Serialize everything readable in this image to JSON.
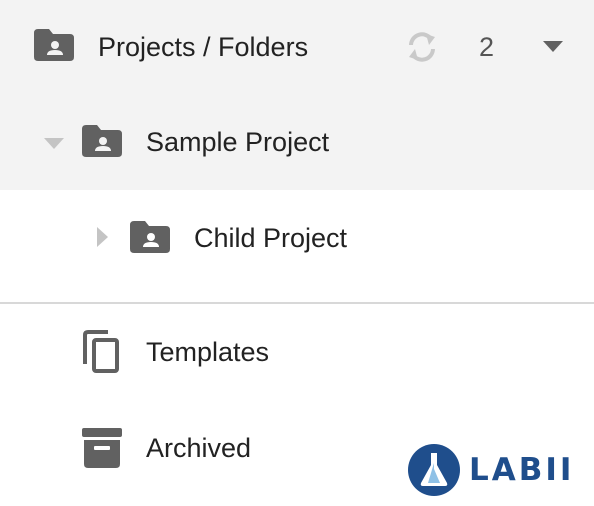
{
  "header": {
    "title": "Projects / Folders",
    "count": "2",
    "icons": [
      "folder-shared-icon",
      "sync-icon",
      "caret-down-icon"
    ]
  },
  "tree": [
    {
      "label": "Sample Project",
      "expanded": true,
      "selected": true,
      "icon": "folder-shared-icon",
      "toggle": "caret-down-icon"
    },
    {
      "label": "Child Project",
      "expanded": false,
      "selected": false,
      "icon": "folder-shared-icon",
      "toggle": "caret-right-icon"
    }
  ],
  "links": [
    {
      "label": "Templates",
      "icon": "copy-icon"
    },
    {
      "label": "Archived",
      "icon": "archive-box-icon"
    }
  ],
  "logo": {
    "text": "LABII"
  },
  "colors": {
    "selected_bg": "#f3f3f3",
    "icon_gray": "#616161",
    "logo_blue": "#1f4e8c"
  }
}
